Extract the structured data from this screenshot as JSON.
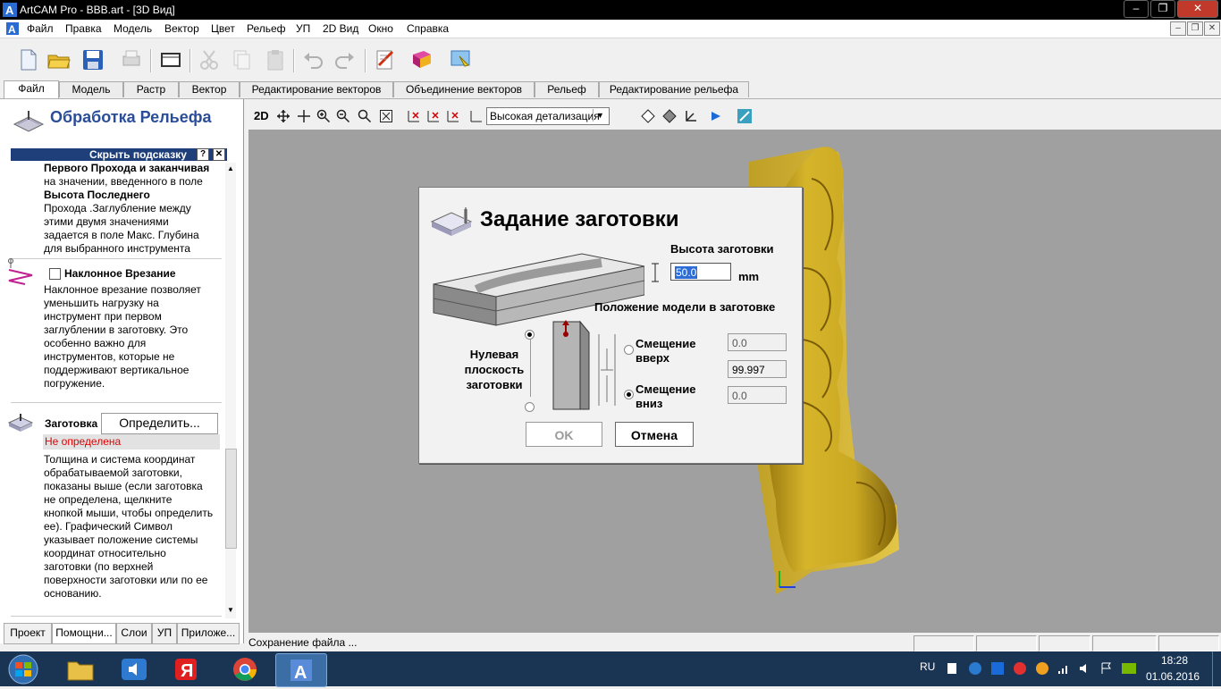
{
  "window": {
    "title": "ArtCAM Pro - BBB.art - [3D Вид]"
  },
  "menu": [
    "Файл",
    "Правка",
    "Модель",
    "Вектор",
    "Цвет",
    "Рельеф",
    "УП",
    "2D Вид",
    "Окно",
    "Справка"
  ],
  "ribbon_tabs": [
    "Файл",
    "Модель",
    "Растр",
    "Вектор",
    "Редактирование векторов",
    "Объединение векторов",
    "Рельеф",
    "Редактирование рельефа"
  ],
  "left_panel": {
    "title": "Обработка Рельефа",
    "hide_hint": "Скрыть подсказку",
    "help_btn": "?",
    "close_btn": "✕",
    "para1_lines": [
      "Первого Прохода и заканчивая",
      "на значении, введенного в поле",
      "Высота Последнего",
      "Прохода .Заглубление между",
      "этими двумя значениями",
      "задается в поле Макс. Глубина",
      "для выбранного инструмента"
    ],
    "ramp_label": "Наклонное Врезание",
    "ramp_text_lines": [
      "Наклонное врезание позволяет",
      "уменьшить нагрузку на",
      "инструмент при первом",
      "заглублении в заготовку. Это",
      "особенно важно для",
      "инструментов, которые не",
      "поддерживают вертикальное",
      "погружение."
    ],
    "block_label": "Заготовка",
    "define_button": "Определить...",
    "block_status": "Не определена",
    "block_text_lines": [
      "Толщина и система координат",
      "обрабатываемой заготовки,",
      "показаны выше (если заготовка",
      "не определена, щелкните",
      "кнопкой мыши, чтобы определить",
      "ее). Графический Символ",
      "указывает положение системы",
      "координат относительно",
      "заготовки (по верхней",
      "поверхности заготовки или по ее",
      "основанию."
    ],
    "bottom_tabs": [
      "Проект",
      "Помощни...",
      "Слои",
      "УП",
      "Приложе..."
    ]
  },
  "view_toolbar": {
    "btn_2d": "2D",
    "detail_select": "Высокая детализация"
  },
  "dialog": {
    "title": "Задание заготовки",
    "height_label": "Высота заготовки",
    "height_value": "50.0",
    "unit": "mm",
    "position_label": "Положение модели в заготовке",
    "zero_plane_lines": [
      "Нулевая",
      "плоскость",
      "заготовки"
    ],
    "offset_up_lines": [
      "Смещение",
      "вверх"
    ],
    "offset_down_lines": [
      "Смещение",
      "вниз"
    ],
    "offset_up_value": "0.0",
    "middle_value": "99.997",
    "offset_down_value": "0.0",
    "ok": "OK",
    "cancel": "Отмена"
  },
  "status_text": "Сохранение файла ...",
  "tray": {
    "lang": "RU",
    "time": "18:28",
    "date": "01.06.2016"
  },
  "colors": {
    "relief": "#c9a720",
    "viewport": "#a0a0a0",
    "panel_header": "#1f3f7a",
    "title_blue": "#2a4d9a",
    "alert_red": "#e00000"
  }
}
